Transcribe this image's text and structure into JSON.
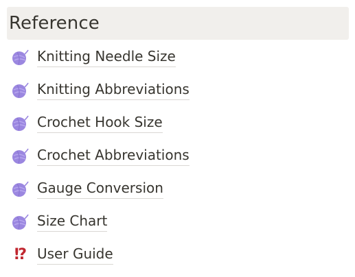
{
  "section": {
    "title": "Reference"
  },
  "items": [
    {
      "label": "Knitting Needle Size",
      "icon": "yarn-ball-icon"
    },
    {
      "label": "Knitting Abbreviations",
      "icon": "yarn-ball-icon"
    },
    {
      "label": "Crochet Hook Size",
      "icon": "yarn-ball-icon"
    },
    {
      "label": "Crochet Abbreviations",
      "icon": "yarn-ball-icon"
    },
    {
      "label": "Gauge Conversion",
      "icon": "yarn-ball-icon"
    },
    {
      "label": "Size Chart",
      "icon": "yarn-ball-icon"
    },
    {
      "label": "User Guide",
      "icon": "exclamation-question-icon",
      "glyph": "⁉"
    }
  ],
  "colors": {
    "header_bg": "#f1efec",
    "text": "#37352f",
    "yarn": "#9b87e0",
    "alert": "#c0262f"
  }
}
